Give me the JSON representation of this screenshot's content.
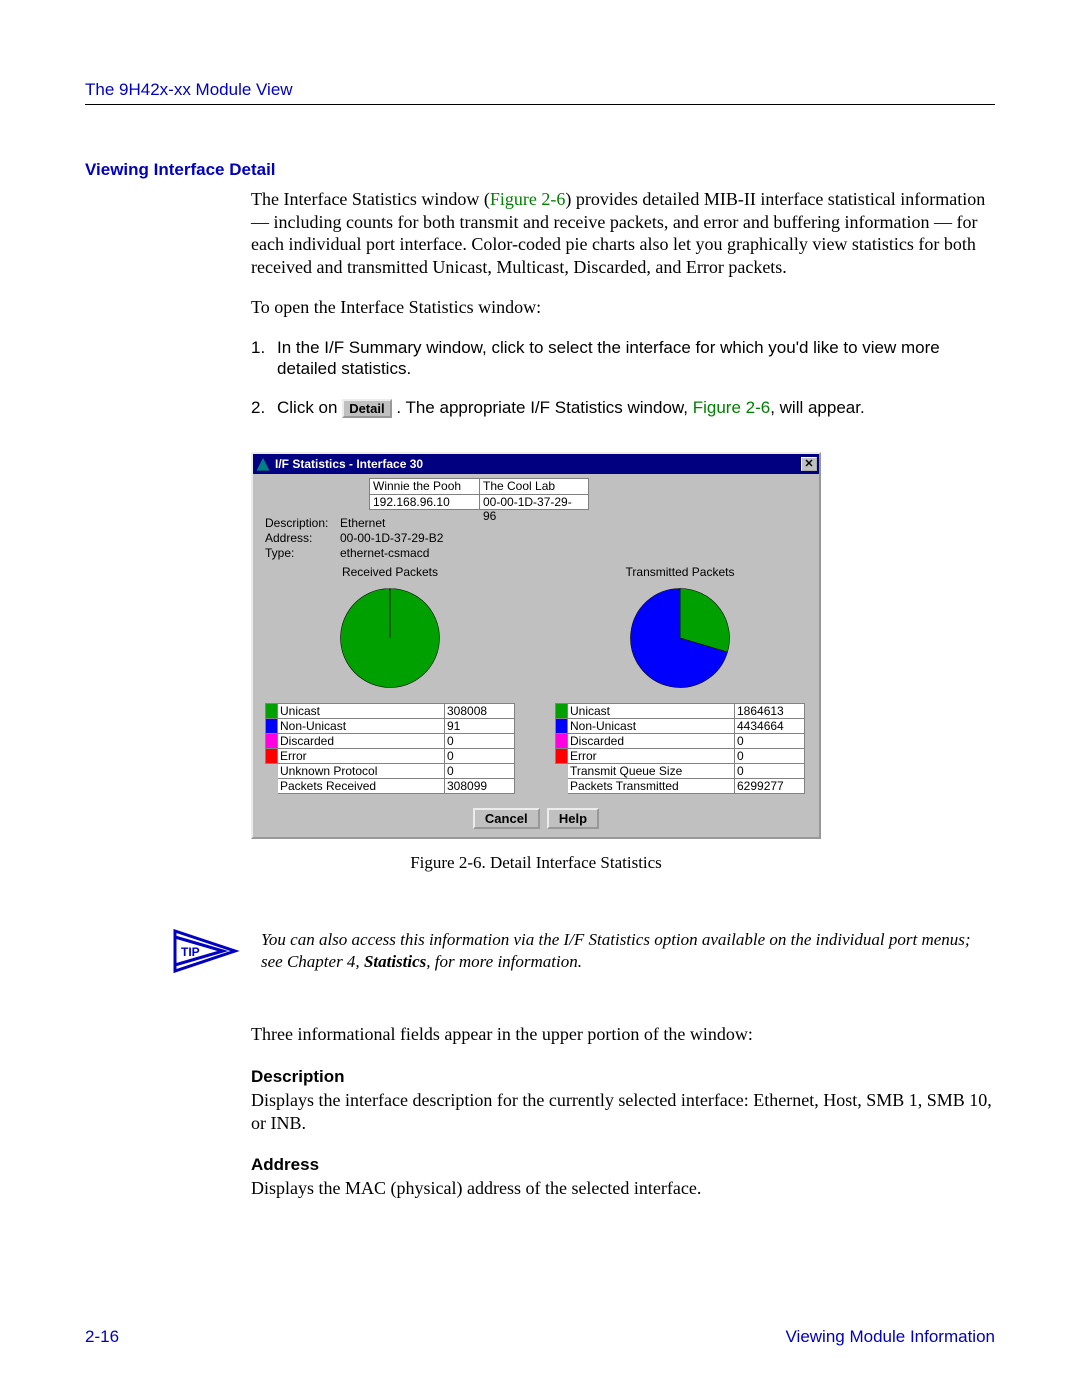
{
  "header": {
    "title": "The 9H42x-xx Module View"
  },
  "section": {
    "heading": "Viewing Interface Detail"
  },
  "intro": {
    "p1a": "The Interface Statistics window (",
    "p1_link": "Figure 2-6",
    "p1b": ") provides detailed MIB-II interface statistical information — including counts for both transmit and receive packets, and error and buffering information — for each individual port interface. Color-coded pie charts also let you graphically view statistics for both received and transmitted Unicast, Multicast, Discarded, and Error packets.",
    "p2": "To open the Interface Statistics window:"
  },
  "steps": {
    "s1": "In the I/F Summary window, click to select the interface for which you'd like to view more detailed statistics.",
    "s2a": "Click on ",
    "detail_btn": "Detail",
    "s2b": ". The appropriate I/F Statistics window, ",
    "s2_link": "Figure 2-6",
    "s2c": ", will appear."
  },
  "window": {
    "title": "I/F Statistics - Interface 30",
    "close": "✕",
    "info": {
      "r1c1": "Winnie the Pooh",
      "r1c2": "The Cool Lab",
      "r2c1": "192.168.96.10",
      "r2c2": "00-00-1D-37-29-96"
    },
    "desc": {
      "l_description": "Description:",
      "v_description": "Ethernet",
      "l_address": "Address:",
      "v_address": "00-00-1D-37-29-B2",
      "l_type": "Type:",
      "v_type": "ethernet-csmacd"
    },
    "rx": {
      "title": "Received Packets",
      "rows": [
        {
          "swatch": "green",
          "label": "Unicast",
          "value": "308008"
        },
        {
          "swatch": "blue",
          "label": "Non-Unicast",
          "value": "91"
        },
        {
          "swatch": "mag",
          "label": "Discarded",
          "value": "0"
        },
        {
          "swatch": "red",
          "label": "Error",
          "value": "0"
        },
        {
          "swatch": "none",
          "label": "Unknown Protocol",
          "value": "0"
        },
        {
          "swatch": "none",
          "label": "Packets Received",
          "value": "308099"
        }
      ]
    },
    "tx": {
      "title": "Transmitted Packets",
      "rows": [
        {
          "swatch": "green",
          "label": "Unicast",
          "value": "1864613"
        },
        {
          "swatch": "blue",
          "label": "Non-Unicast",
          "value": "4434664"
        },
        {
          "swatch": "mag",
          "label": "Discarded",
          "value": "0"
        },
        {
          "swatch": "red",
          "label": "Error",
          "value": "0"
        },
        {
          "swatch": "none",
          "label": "Transmit Queue Size",
          "value": "0"
        },
        {
          "swatch": "none",
          "label": "Packets Transmitted",
          "value": "6299277"
        }
      ]
    },
    "buttons": {
      "cancel": "Cancel",
      "help": "Help"
    }
  },
  "figure_caption": "Figure 2-6. Detail Interface Statistics",
  "tip": {
    "label": "TIP",
    "text_a": "You can also access this information via the I/F Statistics option available on the individual port menus; see Chapter 4, ",
    "text_b": "Statistics",
    "text_c": ", for more information."
  },
  "post": {
    "p": "Three informational fields appear in the upper portion of the window:",
    "desc_h": "Description",
    "desc_p": "Displays the interface description for the currently selected interface: Ethernet, Host, SMB 1, SMB 10, or INB.",
    "addr_h": "Address",
    "addr_p": "Displays the MAC (physical) address of the selected interface."
  },
  "footer": {
    "pageno": "2-16",
    "section": "Viewing Module Information"
  },
  "chart_data": [
    {
      "type": "pie",
      "title": "Received Packets",
      "series": [
        {
          "name": "Unicast",
          "value": 308008,
          "color": "#00a000"
        },
        {
          "name": "Non-Unicast",
          "value": 91,
          "color": "#0000ff"
        },
        {
          "name": "Discarded",
          "value": 0,
          "color": "#ff00e0"
        },
        {
          "name": "Error",
          "value": 0,
          "color": "#ff0000"
        }
      ]
    },
    {
      "type": "pie",
      "title": "Transmitted Packets",
      "series": [
        {
          "name": "Unicast",
          "value": 1864613,
          "color": "#00a000"
        },
        {
          "name": "Non-Unicast",
          "value": 4434664,
          "color": "#0000ff"
        },
        {
          "name": "Discarded",
          "value": 0,
          "color": "#ff00e0"
        },
        {
          "name": "Error",
          "value": 0,
          "color": "#ff0000"
        }
      ]
    }
  ]
}
